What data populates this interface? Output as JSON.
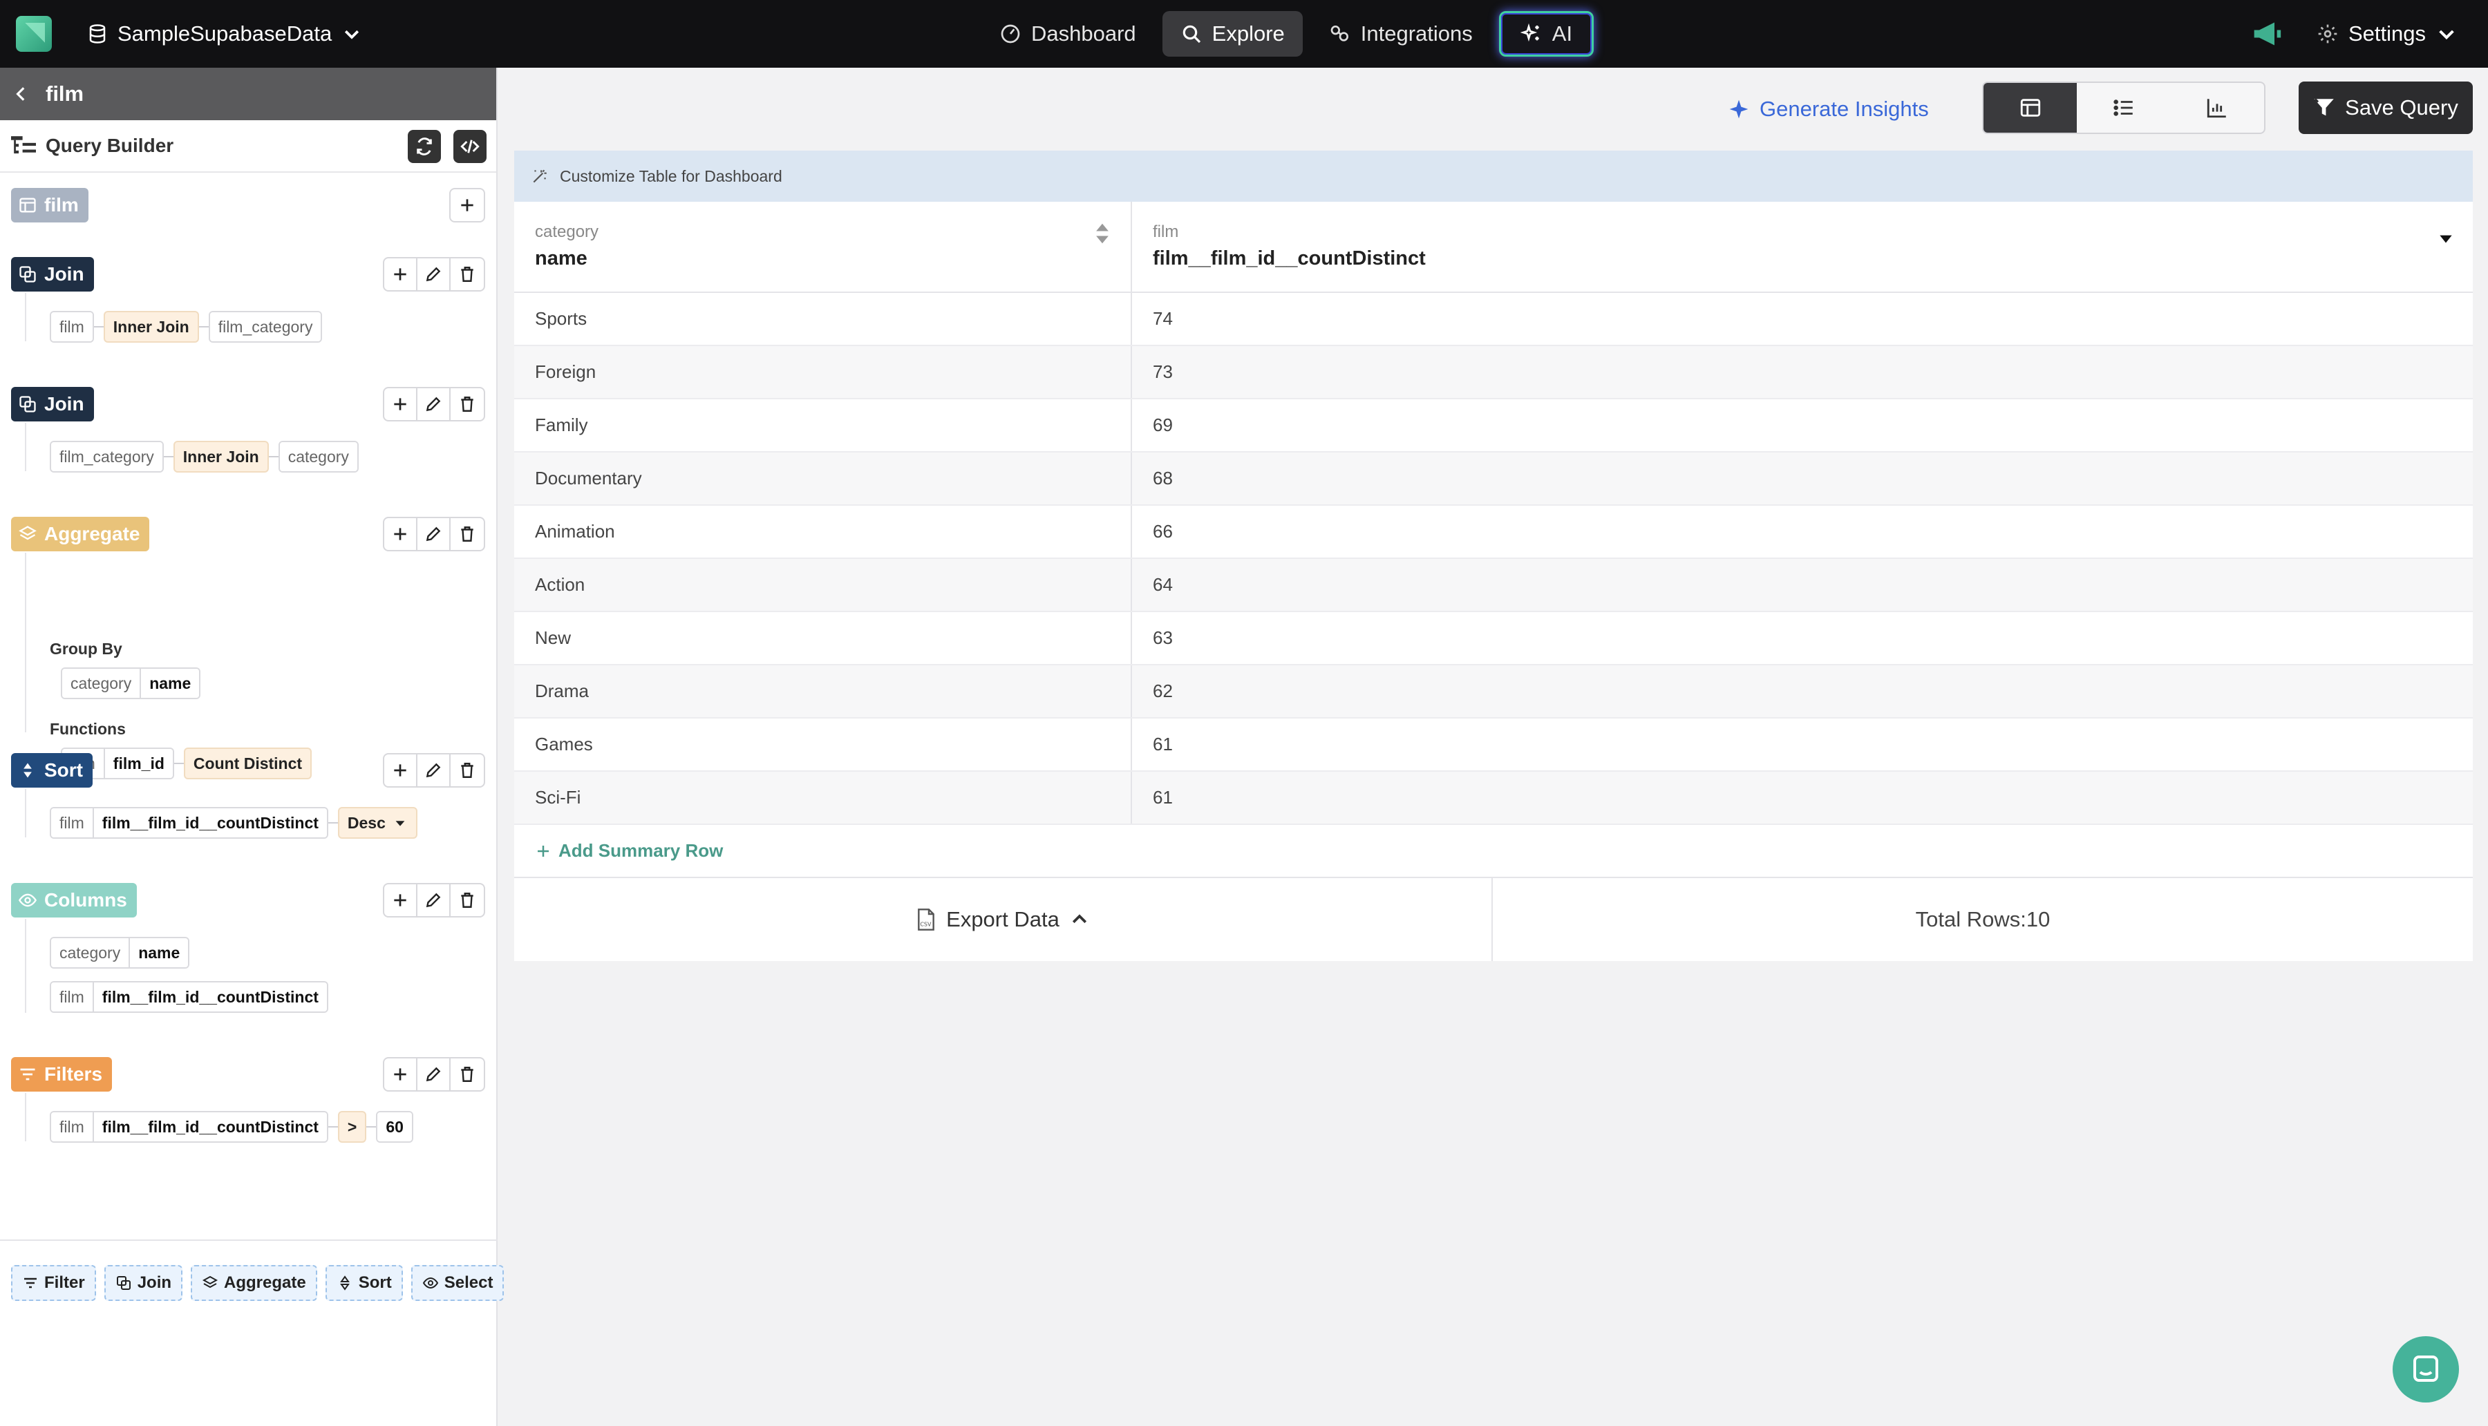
{
  "topbar": {
    "datasource": "SampleSupabaseData",
    "tabs": [
      {
        "label": "Dashboard",
        "icon": "gauge-icon"
      },
      {
        "label": "Explore",
        "icon": "search-icon"
      },
      {
        "label": "Integrations",
        "icon": "integrations-icon"
      },
      {
        "label": "AI",
        "icon": "sparkles-icon"
      }
    ],
    "active_tab": "Explore",
    "settings_label": "Settings"
  },
  "left": {
    "table_name": "film",
    "query_builder_label": "Query Builder",
    "source_tag": "film",
    "join1": {
      "tag": "Join",
      "left": "film",
      "type": "Inner Join",
      "right": "film_category"
    },
    "join2": {
      "tag": "Join",
      "left": "film_category",
      "type": "Inner Join",
      "right": "category"
    },
    "aggregate": {
      "tag": "Aggregate",
      "group_by_label": "Group By",
      "group_by": {
        "table": "category",
        "column": "name"
      },
      "functions_label": "Functions",
      "function": {
        "table": "film",
        "column": "film_id",
        "op": "Count Distinct"
      }
    },
    "sort": {
      "tag": "Sort",
      "table": "film",
      "column": "film__film_id__countDistinct",
      "direction": "Desc"
    },
    "columns": {
      "tag": "Columns",
      "items": [
        {
          "table": "category",
          "column": "name"
        },
        {
          "table": "film",
          "column": "film__film_id__countDistinct"
        }
      ]
    },
    "filters": {
      "tag": "Filters",
      "table": "film",
      "column": "film__film_id__countDistinct",
      "op": ">",
      "value": "60"
    },
    "bottom_buttons": [
      "Filter",
      "Join",
      "Aggregate",
      "Sort",
      "Select"
    ]
  },
  "main": {
    "generate_insights": "Generate Insights",
    "save_query": "Save Query",
    "customize_label": "Customize Table for Dashboard",
    "columns": [
      {
        "table": "category",
        "name": "name"
      },
      {
        "table": "film",
        "name": "film__film_id__countDistinct"
      }
    ],
    "rows": [
      [
        "Sports",
        "74"
      ],
      [
        "Foreign",
        "73"
      ],
      [
        "Family",
        "69"
      ],
      [
        "Documentary",
        "68"
      ],
      [
        "Animation",
        "66"
      ],
      [
        "Action",
        "64"
      ],
      [
        "New",
        "63"
      ],
      [
        "Drama",
        "62"
      ],
      [
        "Games",
        "61"
      ],
      [
        "Sci-Fi",
        "61"
      ]
    ],
    "add_summary_row": "Add Summary Row",
    "export_data": "Export Data",
    "total_rows": "Total Rows:10"
  },
  "colors": {
    "topbar_bg": "#111113",
    "accent_teal": "#45b39a",
    "accent_blue": "#3a68d8",
    "aggregate_tag": "#e9c37a",
    "filters_tag": "#ef9d52",
    "columns_tag": "#8fd3c6"
  }
}
